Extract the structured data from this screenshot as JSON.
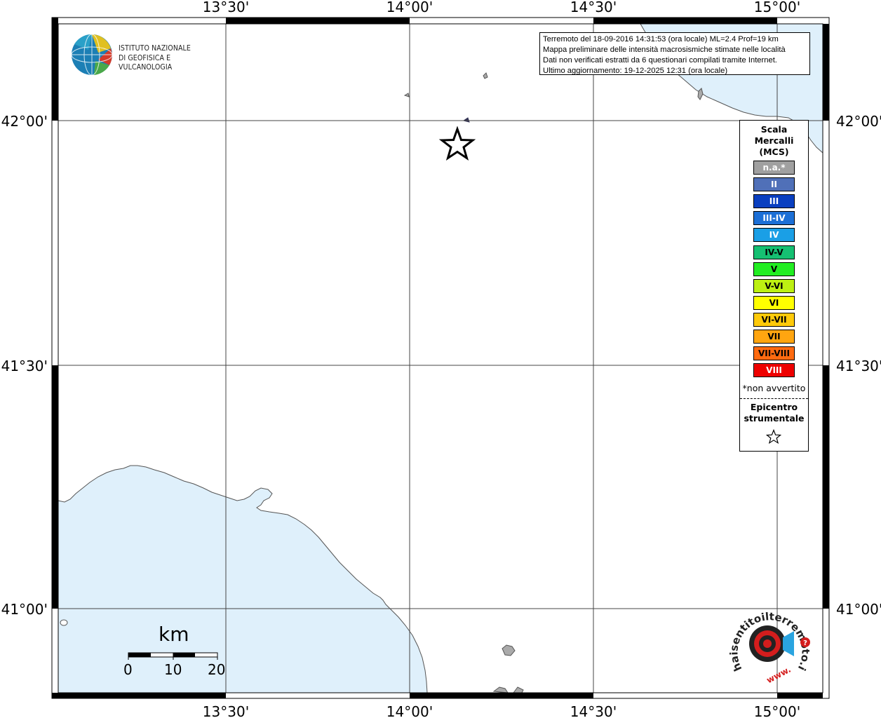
{
  "map": {
    "lon_labels": [
      "13°30'",
      "14°00'",
      "14°30'",
      "15°00'"
    ],
    "lat_labels": [
      "42°00'",
      "41°30'",
      "41°00'"
    ]
  },
  "info": {
    "line1": "Terremoto del 18-09-2016 14:31:53 (ora locale) ML=2.4 Prof=19 km",
    "line2": "Mappa preliminare delle intensità macrosismiche stimate nelle località",
    "line3": "Dati non verificati estratti da 6 questionari compilati tramite Internet.",
    "line4": "Ultimo aggiornamento: 19-12-2025 12:31 (ora locale)"
  },
  "logo": {
    "line1": "ISTITUTO NAZIONALE",
    "line2": "DI GEOFISICA E VULCANOLOGIA"
  },
  "legend": {
    "title1": "Scala",
    "title2": "Mercalli",
    "title3": "(MCS)",
    "items": [
      {
        "label": "n.a.*",
        "color": "#a0a0a0",
        "text_color": "#ffffff"
      },
      {
        "label": "II",
        "color": "#5070b8",
        "text_color": "#ffffff"
      },
      {
        "label": "III",
        "color": "#0a3fc0",
        "text_color": "#ffffff"
      },
      {
        "label": "III-IV",
        "color": "#1c6fd6",
        "text_color": "#ffffff"
      },
      {
        "label": "IV",
        "color": "#1a9fe6",
        "text_color": "#ffffff"
      },
      {
        "label": "IV-V",
        "color": "#15c072",
        "text_color": "#000000"
      },
      {
        "label": "V",
        "color": "#22ee22",
        "text_color": "#000000"
      },
      {
        "label": "V-VI",
        "color": "#bdf012",
        "text_color": "#000000"
      },
      {
        "label": "VI",
        "color": "#ffff00",
        "text_color": "#000000"
      },
      {
        "label": "VI-VII",
        "color": "#ffca0a",
        "text_color": "#000000"
      },
      {
        "label": "VII",
        "color": "#ffa510",
        "text_color": "#000000"
      },
      {
        "label": "VII-VIII",
        "color": "#ff6a10",
        "text_color": "#000000"
      },
      {
        "label": "VIII",
        "color": "#ee0000",
        "text_color": "#ffffff"
      }
    ],
    "note": "*non avvertito",
    "epi1": "Epicentro",
    "epi2": "strumentale"
  },
  "scalebar": {
    "unit": "km",
    "ticks": [
      "0",
      "10",
      "20"
    ]
  },
  "haisentito": {
    "text": "haisentitoilterremoto.it",
    "www": "www."
  },
  "colors": {
    "sea": "#dff0fb",
    "coast": "#555555",
    "grid": "#444444"
  }
}
